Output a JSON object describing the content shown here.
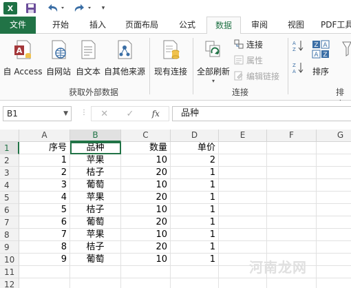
{
  "qat": {
    "app_icon": "X",
    "more": "▾"
  },
  "tabs": [
    "文件",
    "开始",
    "插入",
    "页面布局",
    "公式",
    "数据",
    "审阅",
    "视图",
    "PDF工具"
  ],
  "active_tab": "数据",
  "ribbon": {
    "external": {
      "buttons": [
        "自 Access",
        "自网站",
        "自文本",
        "自其他来源"
      ],
      "existing": "现有连接",
      "group_label": "获取外部数据"
    },
    "connections": {
      "refresh": "全部刷新",
      "links": [
        "连接",
        "属性",
        "编辑链接"
      ],
      "group_label": "连接"
    },
    "sort": {
      "sort_label": "排序",
      "group_label": "排序"
    }
  },
  "formula_bar": {
    "name_box": "B1",
    "cancel": "✕",
    "enter": "✓",
    "fx": "fx",
    "content": "品种"
  },
  "sheet": {
    "columns": [
      "A",
      "B",
      "C",
      "D",
      "E",
      "F",
      "G"
    ],
    "rows": [
      "1",
      "2",
      "3",
      "4",
      "5",
      "6",
      "7",
      "8",
      "9",
      "10",
      "11",
      "12"
    ],
    "cells": [
      [
        "序号",
        "品种",
        "数量",
        "单价"
      ],
      [
        "1",
        "苹果",
        "10",
        "2"
      ],
      [
        "2",
        "桔子",
        "20",
        "1"
      ],
      [
        "3",
        "葡萄",
        "10",
        "1"
      ],
      [
        "4",
        "苹果",
        "20",
        "1"
      ],
      [
        "5",
        "桔子",
        "10",
        "1"
      ],
      [
        "6",
        "葡萄",
        "20",
        "1"
      ],
      [
        "7",
        "苹果",
        "10",
        "1"
      ],
      [
        "8",
        "桔子",
        "20",
        "1"
      ],
      [
        "9",
        "葡萄",
        "10",
        "1"
      ]
    ]
  },
  "watermark": "河南龙网",
  "colors": {
    "excel_green": "#217346",
    "file_tab": "#217346"
  }
}
